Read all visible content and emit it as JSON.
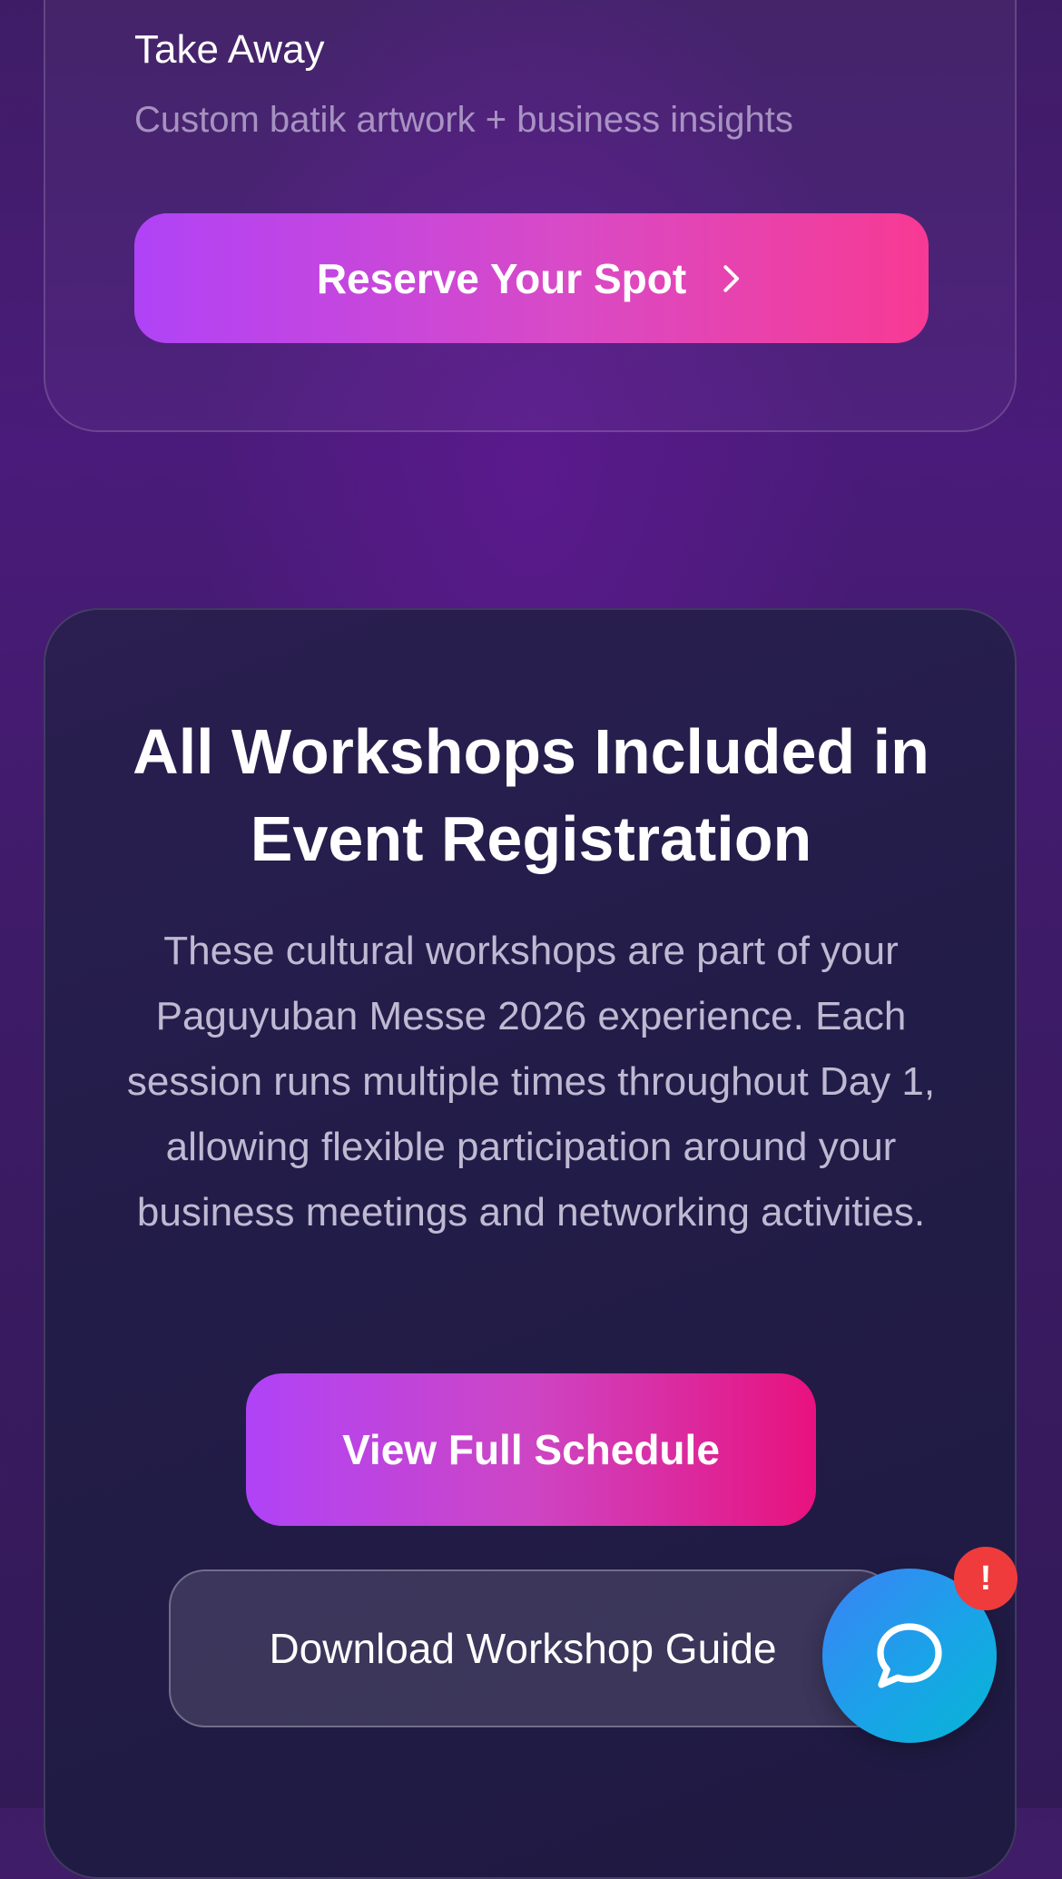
{
  "workshop_card": {
    "takeaway_title": "Take Away",
    "takeaway_text": "Custom batik artwork + business insights",
    "reserve_label": "Reserve Your Spot",
    "reserve_icon": "chevron-right-icon"
  },
  "registration_info": {
    "headline": "All Workshops Included in Event Registration",
    "description": "These cultural workshops are part of your Paguyuban Messe 2026 experience. Each session runs multiple times throughout Day 1, allowing flexible participation around your business meetings and networking activities.",
    "schedule_label": "View Full Schedule",
    "guide_label": "Download Workshop Guide"
  },
  "chat_widget": {
    "icon": "chat-bubble-icon",
    "badge": "!"
  },
  "colors": {
    "accent_purple": "#b043f7",
    "accent_pink": "#f73a93",
    "chat_blue": "#3b82f6",
    "badge_red": "#ef3b3b"
  }
}
